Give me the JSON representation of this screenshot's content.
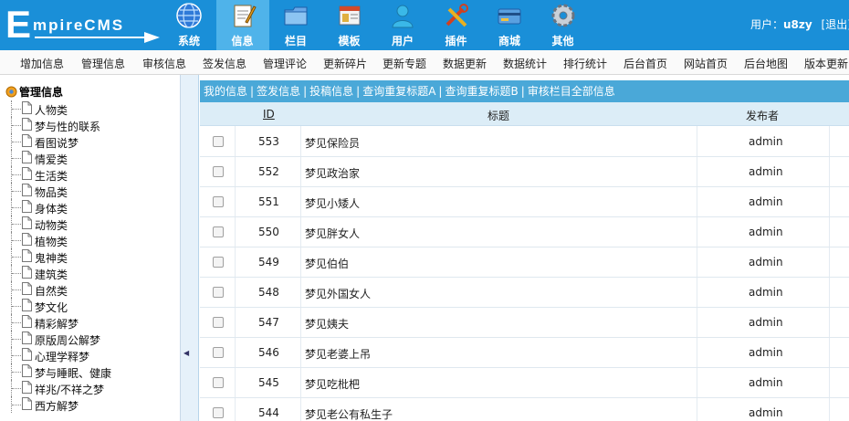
{
  "header": {
    "logo_initial": "E",
    "logo_rest": "mpireCMS",
    "nav": [
      {
        "label": "系统",
        "icon": "globe-icon"
      },
      {
        "label": "信息",
        "icon": "notepad-icon",
        "active": true
      },
      {
        "label": "栏目",
        "icon": "folder-icon"
      },
      {
        "label": "模板",
        "icon": "template-icon"
      },
      {
        "label": "用户",
        "icon": "user-icon"
      },
      {
        "label": "插件",
        "icon": "tools-icon"
      },
      {
        "label": "商城",
        "icon": "card-icon"
      },
      {
        "label": "其他",
        "icon": "gear-icon"
      }
    ],
    "user_prefix": "用户：",
    "user_name": "u8zy",
    "logout": "[退出]"
  },
  "submenu": [
    "增加信息",
    "管理信息",
    "审核信息",
    "签发信息",
    "管理评论",
    "更新碎片",
    "更新专题",
    "数据更新",
    "数据统计",
    "排行统计",
    "后台首页",
    "网站首页",
    "后台地图",
    "版本更新"
  ],
  "sidebar": {
    "root": "管理信息",
    "items": [
      "人物类",
      "梦与性的联系",
      "看图说梦",
      "情爱类",
      "生活类",
      "物品类",
      "身体类",
      "动物类",
      "植物类",
      "鬼神类",
      "建筑类",
      "自然类",
      "梦文化",
      "精彩解梦",
      "原版周公解梦",
      "心理学释梦",
      "梦与睡眠、健康",
      "祥兆/不祥之梦",
      "西方解梦"
    ]
  },
  "main": {
    "tabs": [
      "我的信息",
      "签发信息",
      "投稿信息",
      "查询重复标题A",
      "查询重复标题B",
      "审核栏目全部信息"
    ],
    "separator": "|",
    "columns": {
      "id": "ID",
      "title": "标题",
      "publisher": "发布者"
    },
    "rows": [
      {
        "id": "553",
        "title": "梦见保险员",
        "publisher": "admin"
      },
      {
        "id": "552",
        "title": "梦见政治家",
        "publisher": "admin"
      },
      {
        "id": "551",
        "title": "梦见小矮人",
        "publisher": "admin"
      },
      {
        "id": "550",
        "title": "梦见胖女人",
        "publisher": "admin"
      },
      {
        "id": "549",
        "title": "梦见伯伯",
        "publisher": "admin"
      },
      {
        "id": "548",
        "title": "梦见外国女人",
        "publisher": "admin"
      },
      {
        "id": "547",
        "title": "梦见姨夫",
        "publisher": "admin"
      },
      {
        "id": "546",
        "title": "梦见老婆上吊",
        "publisher": "admin"
      },
      {
        "id": "545",
        "title": "梦见吃枇杷",
        "publisher": "admin"
      },
      {
        "id": "544",
        "title": "梦见老公有私生子",
        "publisher": "admin"
      }
    ]
  }
}
